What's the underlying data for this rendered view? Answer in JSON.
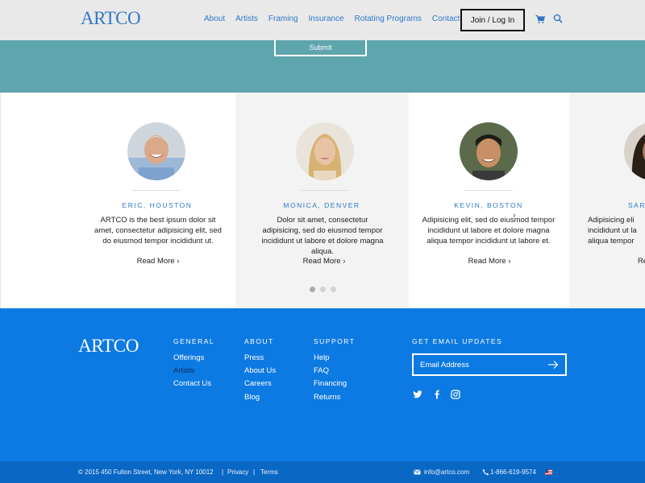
{
  "header": {
    "logo": "ARTCO",
    "nav": [
      "About",
      "Artists",
      "Framing",
      "Insurance",
      "Rotating Programs",
      "Contact"
    ],
    "join_label": "Join / Log In",
    "cart_icon": "cart-icon",
    "search_icon": "search-icon"
  },
  "hero": {
    "submit_label": "Submit",
    "bg_color": "#5fa5ad"
  },
  "testimonials": [
    {
      "name": "ERIC, HOUSTON",
      "quote": "ARTCO is the best ipsum dolor sit amet, consectetur adipisicing elit, sed do eiusmod tempor incididunt ut.",
      "read_more": "Read More"
    },
    {
      "name": "MONICA, DENVER",
      "quote": "Dolor sit amet, consectetur adipisicing, sed do eiusmod tempor incididunt ut labore et dolore magna aliqua.",
      "read_more": "Read More"
    },
    {
      "name": "KEVIN, BOSTON",
      "quote": "Adipisicing elit, sed do eiusmod tempor incididunt ut labore et dolore magna aliqua  tempor incididunt ut labore et.",
      "read_more": "Read More"
    },
    {
      "name": "SARA",
      "quote": "Adipisicing eli incididunt ut la aliqua  tempor",
      "read_more": "Re"
    }
  ],
  "footer": {
    "logo": "ARTCO",
    "columns": [
      {
        "heading": "GENERAL",
        "items": [
          "Offerings",
          "Artists",
          "Contact Us"
        ]
      },
      {
        "heading": "ABOUT",
        "items": [
          "Press",
          "About Us",
          "Careers",
          "Blog"
        ]
      },
      {
        "heading": "SUPPORT",
        "items": [
          "Help",
          "FAQ",
          "Financing",
          "Returns"
        ]
      }
    ],
    "email_heading": "GET EMAIL UPDATES",
    "email_placeholder": "Email Address",
    "social_icons": [
      "twitter-icon",
      "facebook-icon",
      "instagram-icon"
    ],
    "bg_color": "#0d7ae3"
  },
  "bottombar": {
    "copyright": "© 2015  450 Fulton Street, New York, NY 10012",
    "privacy": "Privacy",
    "terms": "Terms",
    "email": "info@artco.com",
    "phone": "1-866-619-9574",
    "flag_icon": "us-flag-icon"
  }
}
